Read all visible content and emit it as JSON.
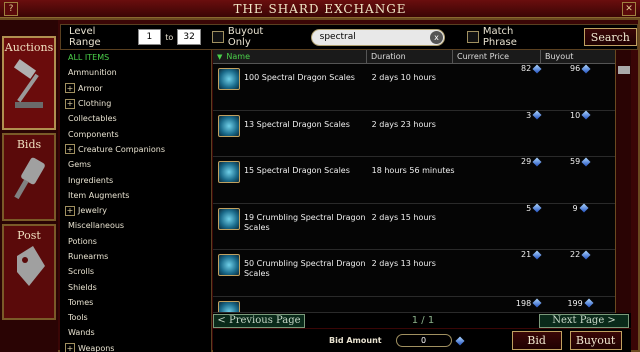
{
  "window": {
    "title": "THE SHARD EXCHANGE"
  },
  "sidebar": {
    "tabs": [
      {
        "label": "Auctions"
      },
      {
        "label": "Bids"
      },
      {
        "label": "Post"
      }
    ]
  },
  "filters": {
    "level_range_label": "Level Range",
    "level_from": "1",
    "to_label": "to",
    "level_to": "32",
    "buyout_only_label": "Buyout Only",
    "search_value": "spectral",
    "clear_glyph": "x",
    "match_phrase_label": "Match Phrase",
    "search_button": "Search"
  },
  "categories": [
    {
      "label": "ALL ITEMS",
      "expandable": false
    },
    {
      "label": "Ammunition",
      "expandable": false
    },
    {
      "label": "Armor",
      "expandable": true
    },
    {
      "label": "Clothing",
      "expandable": true
    },
    {
      "label": "Collectables",
      "expandable": false
    },
    {
      "label": "Components",
      "expandable": false
    },
    {
      "label": "Creature Companions",
      "expandable": true
    },
    {
      "label": "Gems",
      "expandable": false
    },
    {
      "label": "Ingredients",
      "expandable": false
    },
    {
      "label": "Item Augments",
      "expandable": false
    },
    {
      "label": "Jewelry",
      "expandable": true
    },
    {
      "label": "Miscellaneous",
      "expandable": false
    },
    {
      "label": "Potions",
      "expandable": false
    },
    {
      "label": "Runearms",
      "expandable": false
    },
    {
      "label": "Scrolls",
      "expandable": false
    },
    {
      "label": "Shields",
      "expandable": false
    },
    {
      "label": "Tomes",
      "expandable": false
    },
    {
      "label": "Tools",
      "expandable": false
    },
    {
      "label": "Wands",
      "expandable": false
    },
    {
      "label": "Weapons",
      "expandable": true
    }
  ],
  "columns": {
    "name": "Name",
    "duration": "Duration",
    "current_price": "Current Price",
    "buyout": "Buyout"
  },
  "listings": [
    {
      "name": "100 Spectral Dragon Scales",
      "duration": "2 days 10 hours",
      "current_price": "82",
      "buyout": "96"
    },
    {
      "name": "13 Spectral Dragon Scales",
      "duration": "2 days 23 hours",
      "current_price": "3",
      "buyout": "10"
    },
    {
      "name": "15 Spectral Dragon Scales",
      "duration": "18 hours 56 minutes",
      "current_price": "29",
      "buyout": "59"
    },
    {
      "name": "19 Crumbling Spectral Dragon Scales",
      "duration": "2 days 15 hours",
      "current_price": "5",
      "buyout": "9"
    },
    {
      "name": "50 Crumbling Spectral Dragon Scales",
      "duration": "2 days 13 hours",
      "current_price": "21",
      "buyout": "22"
    },
    {
      "name": "",
      "duration": "",
      "current_price": "198",
      "buyout": "199"
    }
  ],
  "pagination": {
    "prev_label": "< Previous Page",
    "page_info": "1 / 1",
    "next_label": "Next Page >"
  },
  "bid": {
    "amount_label": "Bid Amount",
    "amount_value": "0",
    "bid_button": "Bid",
    "buyout_button": "Buyout"
  },
  "colors": {
    "frame_red": "#3a0606",
    "gold_border": "#c0a060",
    "selected_category": "#4ad04a"
  }
}
